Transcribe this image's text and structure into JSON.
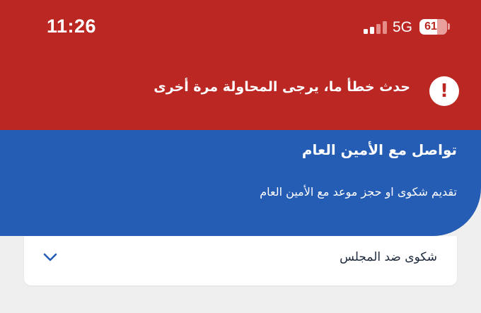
{
  "status_bar": {
    "time": "11:26",
    "network": "5G",
    "battery": "61",
    "signal_bars_active": 2,
    "signal_bars_total": 4
  },
  "error_banner": {
    "icon": "exclamation-icon",
    "glyph": "!",
    "message": "حدث خطأ ما، يرجى المحاولة مرة أخرى",
    "color": "#bb2722"
  },
  "header": {
    "title": "تواصل مع الأمين العام",
    "subtitle": "تقديم شكوى او حجز موعد مع الأمين العام",
    "color": "#255cb4"
  },
  "dropdown": {
    "selected": "شكوى ضد المجلس",
    "icon": "chevron-down-icon"
  }
}
